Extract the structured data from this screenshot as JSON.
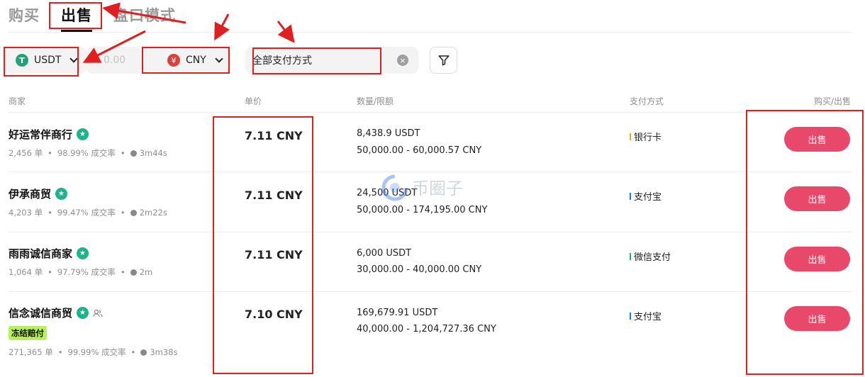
{
  "tabs": {
    "buy": "购买",
    "sell": "出售",
    "depth": "盘口模式"
  },
  "filters": {
    "coin": "USDT",
    "amount_placeholder": "0.00",
    "fiat": "CNY",
    "payment": "全部支付方式"
  },
  "headers": {
    "merchant": "商家",
    "price": "单价",
    "quantity": "数量/限额",
    "payment": "支付方式",
    "action": "购买/出售"
  },
  "rows": [
    {
      "name": "好运常伴商行",
      "orders": "2,456 单",
      "rate": "98.99% 成交率",
      "time": "3m44s",
      "price": "7.11 CNY",
      "qty": "8,438.9 USDT",
      "limit": "50,000.00 - 60,000.57 CNY",
      "payment": "银行卡",
      "payment_color": "#f5a623",
      "action": "出售"
    },
    {
      "name": "伊承商贸",
      "orders": "4,203 单",
      "rate": "99.47% 成交率",
      "time": "2m22s",
      "price": "7.11 CNY",
      "qty": "24,500 USDT",
      "limit": "50,000.00 - 174,195.00 CNY",
      "payment": "支付宝",
      "payment_color": "#1677ff",
      "action": "出售"
    },
    {
      "name": "雨雨诚信商家",
      "orders": "1,064 单",
      "rate": "97.79% 成交率",
      "time": "2m",
      "price": "7.11 CNY",
      "qty": "6,000 USDT",
      "limit": "30,000.00 - 40,000.00 CNY",
      "payment": "微信支付",
      "payment_color": "#07c160",
      "action": "出售"
    },
    {
      "name": "信念诚信商贸",
      "badge": "冻结赔付",
      "orders": "271,365 单",
      "rate": "99.99% 成交率",
      "time": "3m38s",
      "price": "7.10 CNY",
      "qty": "169,679.91 USDT",
      "limit": "40,000.00 - 1,204,727.36 CNY",
      "payment": "支付宝",
      "payment_color": "#1677ff",
      "action": "出售"
    }
  ],
  "colors": {
    "sell": "#e8486a",
    "verified": "#1eb38a",
    "annotation": "#e02020",
    "badge": "#b7f05d"
  },
  "watermark": "币圈子"
}
